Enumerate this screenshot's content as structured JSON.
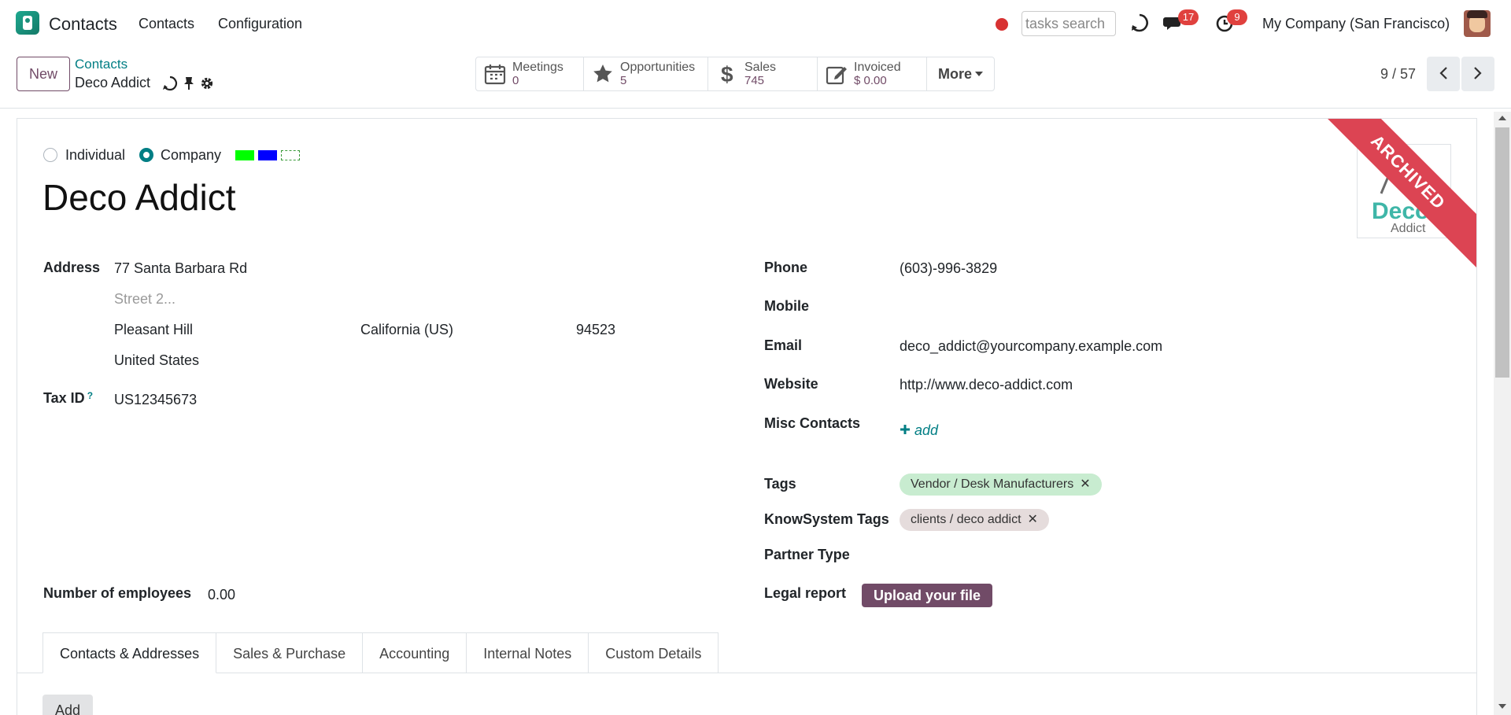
{
  "navbar": {
    "brand": "Contacts",
    "menu": [
      "Contacts",
      "Configuration"
    ],
    "search_placeholder": "tasks search",
    "messages_count": "17",
    "activities_count": "9",
    "company": "My Company (San Francisco)"
  },
  "control_panel": {
    "new_label": "New",
    "breadcrumb_parent": "Contacts",
    "breadcrumb_current": "Deco Addict",
    "stats": [
      {
        "label": "Meetings",
        "value": "0"
      },
      {
        "label": "Opportunities",
        "value": "5"
      },
      {
        "label": "Sales",
        "value": "745"
      },
      {
        "label": "Invoiced",
        "value": "$ 0.00"
      }
    ],
    "more_label": "More",
    "pager": "9 / 57"
  },
  "form": {
    "ribbon": "ARCHIVED",
    "logo_text": "Deco",
    "logo_subtext": "Addict",
    "type_individual": "Individual",
    "type_company": "Company",
    "selected_type": "Company",
    "color_swatches": [
      "#00ff00",
      "#0000ff"
    ],
    "name": "Deco Addict",
    "address_label": "Address",
    "street": "77 Santa Barbara Rd",
    "street2_placeholder": "Street 2...",
    "city": "Pleasant Hill",
    "state": "California (US)",
    "zip": "94523",
    "country": "United States",
    "tax_id_label": "Tax ID",
    "tax_id_help": "?",
    "tax_id": "US12345673",
    "employees_label": "Number of employees",
    "employees": "0.00",
    "phone_label": "Phone",
    "phone": "(603)-996-3829",
    "mobile_label": "Mobile",
    "email_label": "Email",
    "email": "deco_addict@yourcompany.example.com",
    "website_label": "Website",
    "website": "http://www.deco-addict.com",
    "misc_contacts_label": "Misc Contacts",
    "misc_add": "add",
    "tags_label": "Tags",
    "tags": [
      {
        "label": "Vendor / Desk Manufacturers",
        "color": "#c8ecd0"
      }
    ],
    "knowsystem_tags_label": "KnowSystem Tags",
    "knowsystem_tags": [
      {
        "label": "clients / deco addict",
        "color": "#e5dcdc"
      }
    ],
    "partner_type_label": "Partner Type",
    "legal_report_label": "Legal report",
    "upload_label": "Upload your file",
    "remove_glyph": "✕"
  },
  "tabs": [
    "Contacts & Addresses",
    "Sales & Purchase",
    "Accounting",
    "Internal Notes",
    "Custom Details"
  ],
  "add_button": "Add",
  "colors": {
    "primary": "#714b67",
    "link": "#017e84",
    "ribbon": "#dc4453",
    "badge": "#e0413e"
  }
}
